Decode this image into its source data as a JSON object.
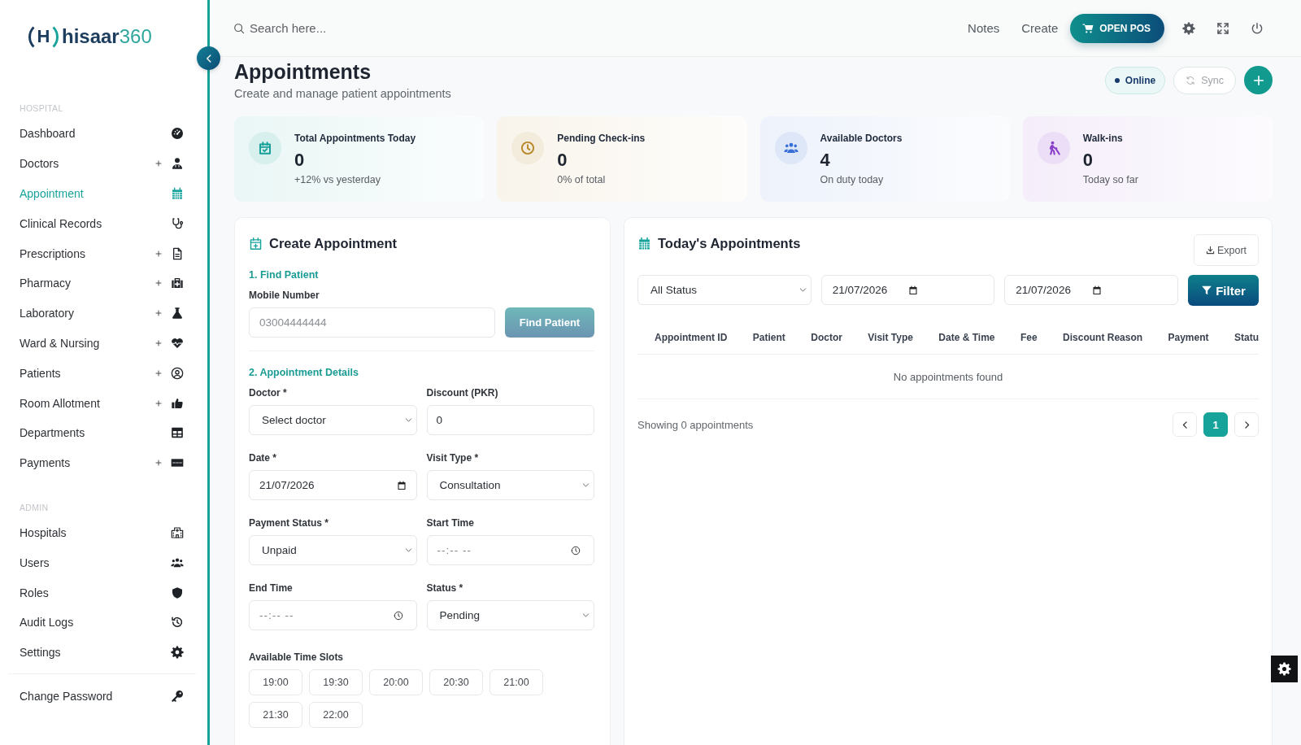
{
  "sidebar": {
    "logo": {
      "mark": "H",
      "name": "hisaar",
      "suffix": "360"
    },
    "sections": [
      {
        "title": "HOSPITAL",
        "items": [
          {
            "label": "Dashboard",
            "has_submenu": false,
            "selected": false
          },
          {
            "label": "Doctors",
            "has_submenu": true,
            "selected": false
          },
          {
            "label": "Appointment",
            "has_submenu": false,
            "selected": true
          },
          {
            "label": "Clinical Records",
            "has_submenu": false,
            "selected": false
          },
          {
            "label": "Prescriptions",
            "has_submenu": true,
            "selected": false
          },
          {
            "label": "Pharmacy",
            "has_submenu": true,
            "selected": false
          },
          {
            "label": "Laboratory",
            "has_submenu": true,
            "selected": false
          },
          {
            "label": "Ward & Nursing",
            "has_submenu": true,
            "selected": false
          },
          {
            "label": "Patients",
            "has_submenu": true,
            "selected": false
          },
          {
            "label": "Room Allotment",
            "has_submenu": true,
            "selected": false
          },
          {
            "label": "Departments",
            "has_submenu": false,
            "selected": false
          },
          {
            "label": "Payments",
            "has_submenu": true,
            "selected": false
          }
        ]
      },
      {
        "title": "ADMIN",
        "items": [
          {
            "label": "Hospitals",
            "has_submenu": false,
            "selected": false
          },
          {
            "label": "Users",
            "has_submenu": false,
            "selected": false
          },
          {
            "label": "Roles",
            "has_submenu": false,
            "selected": false
          },
          {
            "label": "Audit Logs",
            "has_submenu": false,
            "selected": false
          },
          {
            "label": "Settings",
            "has_submenu": false,
            "selected": false
          }
        ]
      }
    ],
    "footer_items": [
      {
        "label": "Change Password",
        "has_submenu": false,
        "selected": false
      }
    ]
  },
  "top_bar": {
    "search": {
      "placeholder": "Search here..."
    },
    "links": [
      "Notes",
      "Create"
    ],
    "pos_button": "OPEN POS"
  },
  "header": {
    "title": "Appointments",
    "subtitle": "Create and manage patient appointments",
    "status": "Online",
    "sync_button": "Sync"
  },
  "stats": [
    {
      "label": "Total Appointments Today",
      "value": "0",
      "note": "+12% vs yesterday",
      "color": "#14a098"
    },
    {
      "label": "Pending Check-ins",
      "value": "0",
      "note": "0% of total",
      "color": "#b8892a"
    },
    {
      "label": "Available Doctors",
      "value": "4",
      "note": "On duty today",
      "color": "#3b6fd8"
    },
    {
      "label": "Walk-ins",
      "value": "0",
      "note": "Today so far",
      "color": "#8b3fc9"
    }
  ],
  "create_appointment": {
    "title": "Create Appointment",
    "find_section": "1. Find Patient",
    "mobile": {
      "label": "Mobile Number",
      "placeholder": "03004444444"
    },
    "find_button": {
      "label": "Find Patient",
      "disabled": true
    },
    "details_section": "2. Appointment Details",
    "fields": [
      {
        "label": "Doctor *",
        "kind": "select",
        "value": "Select doctor"
      },
      {
        "label": "Discount (PKR)",
        "kind": "number",
        "value": "0"
      },
      {
        "label": "Date *",
        "kind": "date",
        "value": "21/07/2026"
      },
      {
        "label": "Visit Type *",
        "kind": "select",
        "value": "Consultation"
      },
      {
        "label": "Payment Status *",
        "kind": "select",
        "value": "Unpaid"
      },
      {
        "label": "Start Time",
        "kind": "time",
        "placeholder": "--:-- --"
      },
      {
        "label": "End Time",
        "kind": "time",
        "placeholder": "--:-- --"
      },
      {
        "label": "Status *",
        "kind": "select",
        "value": "Pending"
      }
    ],
    "time_slots": {
      "label": "Available Time Slots",
      "slots": [
        {
          "label": "19:00",
          "selected": false
        },
        {
          "label": "19:30",
          "selected": false
        },
        {
          "label": "20:00",
          "selected": false
        },
        {
          "label": "20:30",
          "selected": false
        },
        {
          "label": "21:00",
          "selected": false
        },
        {
          "label": "21:30",
          "selected": false
        },
        {
          "label": "22:00",
          "selected": false
        }
      ]
    }
  },
  "todays_appointments": {
    "title": "Today's Appointments",
    "export_button": "Export",
    "filters": [
      {
        "kind": "select",
        "value": "All Status"
      },
      {
        "kind": "date",
        "value": "21/07/2026"
      },
      {
        "kind": "date",
        "value": "21/07/2026"
      }
    ],
    "filter_button": "Filter",
    "table": {
      "columns": [
        "Appointment ID",
        "Patient",
        "Doctor",
        "Visit Type",
        "Date & Time",
        "Fee",
        "Discount Reason",
        "Payment",
        "Statu"
      ],
      "empty_message": "No appointments found"
    },
    "summary": "Showing 0 appointments",
    "pagination": {
      "pages": [
        {
          "label": "1",
          "selected": true
        }
      ]
    }
  }
}
